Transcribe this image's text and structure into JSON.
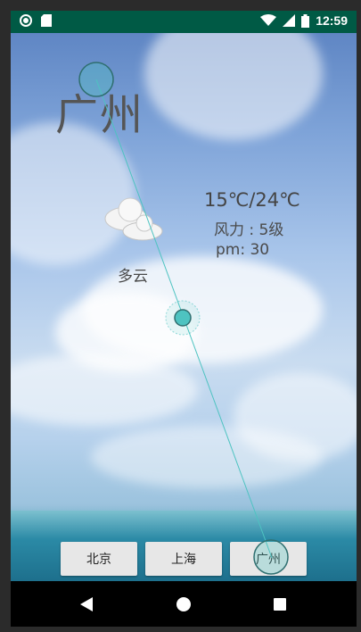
{
  "status_bar": {
    "time": "12:59",
    "icons": [
      "record-icon",
      "sd-card-icon",
      "wifi-icon",
      "signal-icon",
      "battery-icon"
    ]
  },
  "weather": {
    "city": "广州",
    "temperature": "15℃/24℃",
    "wind": "风力 : 5级",
    "pm": "pm: 30",
    "description": "多云",
    "icon": "cloudy-icon"
  },
  "city_buttons": [
    {
      "label": "北京"
    },
    {
      "label": "上海"
    },
    {
      "label": "广州"
    }
  ],
  "nav_bar": {
    "icons": [
      "back-icon",
      "home-icon",
      "recents-icon"
    ]
  },
  "colors": {
    "status_bar": "#005a45",
    "text": "#4a4a4a",
    "touch_indicator": "#4ec3c1"
  }
}
